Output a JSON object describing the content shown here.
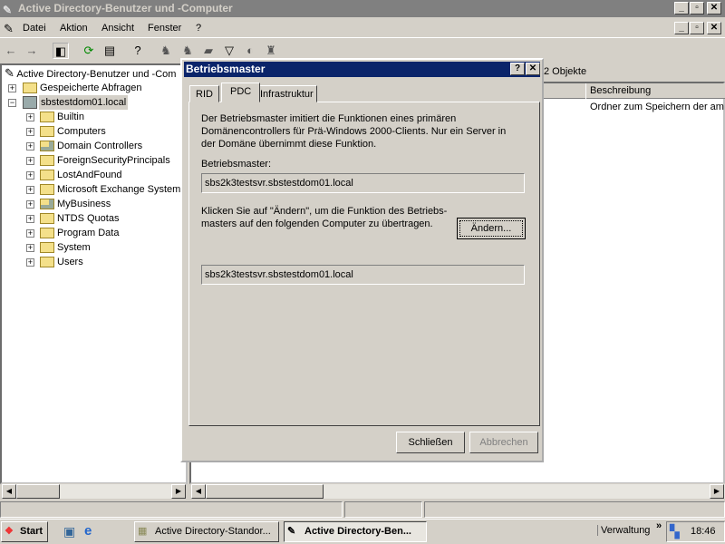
{
  "window": {
    "title": "Active Directory-Benutzer und -Computer",
    "min": "_",
    "max": "▫",
    "close": "✕"
  },
  "menu": [
    "Datei",
    "Aktion",
    "Ansicht",
    "Fenster",
    "?"
  ],
  "tree": {
    "root": "Active Directory-Benutzer und -Com",
    "saved": "Gespeicherte Abfragen",
    "domain": "sbstestdom01.local",
    "children": [
      "Builtin",
      "Computers",
      "Domain Controllers",
      "ForeignSecurityPrincipals",
      "LostAndFound",
      "Microsoft Exchange System",
      "MyBusiness",
      "NTDS Quotas",
      "Program Data",
      "System",
      "Users"
    ]
  },
  "right": {
    "count": "2 Objekte",
    "column": "Beschreibung",
    "row_desc": "Ordner zum Speichern der am I"
  },
  "dialog": {
    "title": "Betriebsmaster",
    "help": "?",
    "close": "✕",
    "tabs": [
      "RID",
      "PDC",
      "Infrastruktur"
    ],
    "active_tab": "PDC",
    "description": "Der Betriebsmaster imitiert die Funktionen eines primären Domänencontrollers für Prä-Windows 2000-Clients. Nur ein Server in der Domäne übernimmt diese Funktion.",
    "master_label": "Betriebsmaster:",
    "master_value": "sbs2k3testsvr.sbstestdom01.local",
    "change_text": "Klicken Sie auf \"Ändern\", um die Funktion des Betriebs-masters auf den folgenden Computer zu übertragen.",
    "change_button": "Ändern...",
    "target_value": "sbs2k3testsvr.sbstestdom01.local",
    "close_button": "Schließen",
    "cancel_button": "Abbrechen"
  },
  "taskbar": {
    "start": "Start",
    "tasks": [
      "Active Directory-Standor...",
      "Active Directory-Ben..."
    ],
    "toolbar": "Verwaltung",
    "chevron": "»",
    "clock": "18:46"
  }
}
